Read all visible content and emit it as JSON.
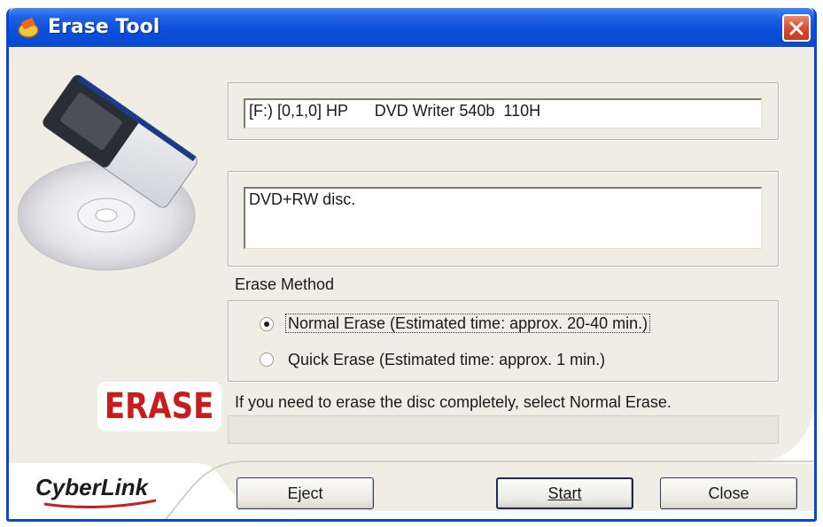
{
  "window": {
    "title": "Erase Tool"
  },
  "drive": {
    "value": "[F:) [0,1,0] HP      DVD Writer 540b  110H"
  },
  "disc": {
    "value": "DVD+RW disc."
  },
  "erase_method": {
    "label": "Erase Method",
    "options": [
      {
        "label": "Normal Erase (Estimated time: approx. 20-40 min.)",
        "selected": true
      },
      {
        "label": "Quick Erase (Estimated time: approx. 1 min.)",
        "selected": false
      }
    ]
  },
  "hint": "If you need to erase the disc completely, select Normal Erase.",
  "logo": {
    "erase": "ERASE",
    "brand": "CyberLink"
  },
  "buttons": {
    "eject": "Eject",
    "start": "Start",
    "close": "Close"
  },
  "colors": {
    "titlebar": "#0b4fdc",
    "close_button": "#d8492b",
    "erase_logo": "#c71d1d",
    "panel": "#efede4"
  },
  "icons": {
    "app": "erase-tool-app-icon",
    "close": "close-icon",
    "art": "eraser-disc-icon"
  }
}
